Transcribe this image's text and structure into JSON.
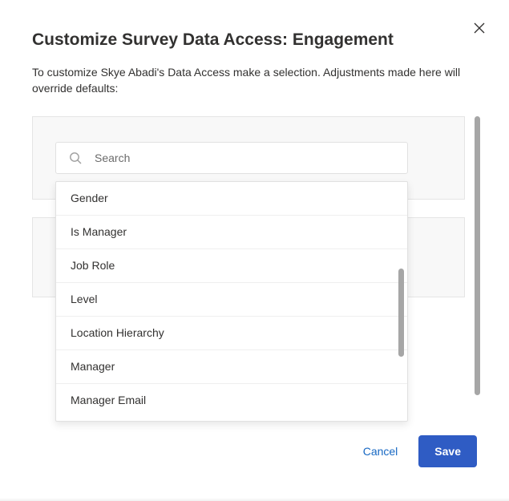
{
  "header": {
    "title": "Customize Survey Data Access: Engagement",
    "subtitle": "To customize Skye Abadi's Data Access make a selection. Adjustments made here will override defaults:"
  },
  "search": {
    "placeholder": "Search",
    "value": ""
  },
  "dropdown": {
    "options": [
      "Gender",
      "Is Manager",
      "Job Role",
      "Level",
      "Location Hierarchy",
      "Manager",
      "Manager Email"
    ]
  },
  "footer": {
    "cancel_label": "Cancel",
    "save_label": "Save"
  }
}
